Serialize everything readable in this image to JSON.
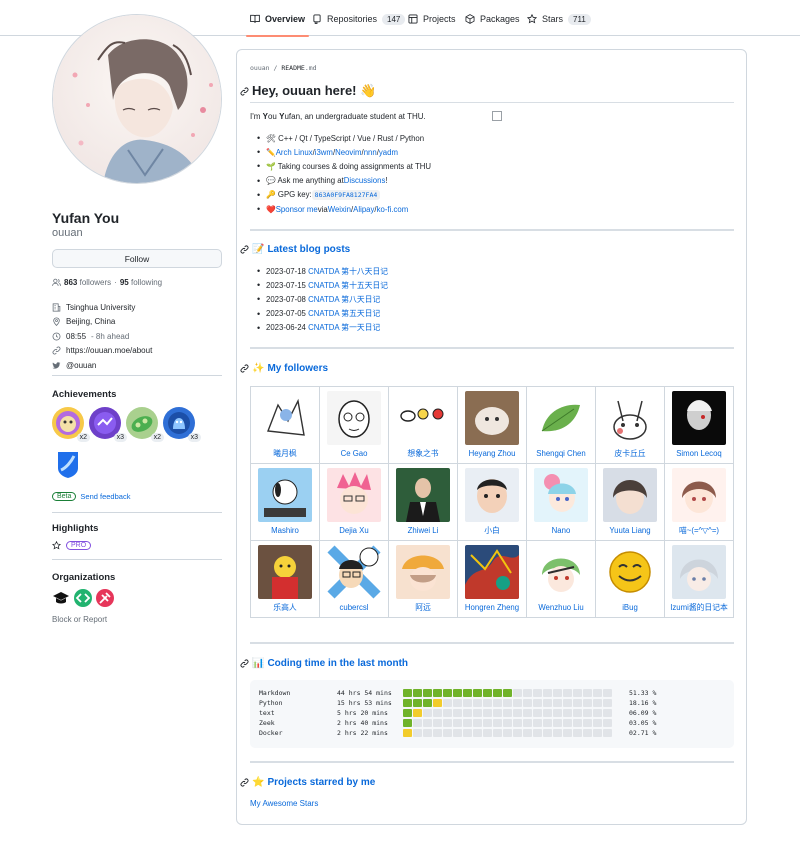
{
  "nav": {
    "tabs": [
      {
        "label": "Overview",
        "count": ""
      },
      {
        "label": "Repositories",
        "count": "147"
      },
      {
        "label": "Projects",
        "count": ""
      },
      {
        "label": "Packages",
        "count": ""
      },
      {
        "label": "Stars",
        "count": "711"
      }
    ]
  },
  "profile": {
    "name": "Yufan You",
    "login": "ouuan",
    "follow_label": "Follow",
    "followers_count": "863",
    "followers_label": "followers",
    "dot": "·",
    "following_count": "95",
    "following_label": "following",
    "org": "Tsinghua University",
    "location": "Beijing, China",
    "time": "08:55",
    "time_note": "- 8h ahead",
    "website": "https://ouuan.moe/about",
    "twitter": "@ouuan"
  },
  "achievements": {
    "title": "Achievements",
    "badges": [
      {
        "icon": "pull-shark-icon",
        "count": "x2",
        "color": "#f7c948"
      },
      {
        "icon": "starstruck-icon",
        "count": "x3",
        "color": "#6e40c9"
      },
      {
        "icon": "pair-extraordinaire-icon",
        "count": "x2",
        "color": "#34a853"
      },
      {
        "icon": "galaxy-brain-icon",
        "count": "x3",
        "color": "#2f6fd6"
      },
      {
        "icon": "yolo-icon",
        "count": "",
        "color": "#1f6feb"
      }
    ],
    "beta": "Beta",
    "feedback": "Send feedback"
  },
  "highlights": {
    "title": "Highlights",
    "pro": "PRO"
  },
  "organizations": {
    "title": "Organizations",
    "block": "Block or Report"
  },
  "readme": {
    "crumb_user": "ouuan",
    "crumb_sep": " / ",
    "crumb_file": "README",
    "crumb_ext": ".md",
    "title": "Hey, ouuan here! 👋",
    "intro_pre": "I'm ",
    "intro_y1": "Y",
    "intro_ou": "ou ",
    "intro_y2": "Y",
    "intro_ufan": "ufan",
    "intro_post": ", an undergraduate student at THU.",
    "bullets": {
      "b1": "🛠 C++ / Qt / TypeScript / Vue / Rust / Python",
      "b2_icon": "✏️ ",
      "b2_arch": "Arch Linux",
      "b2_s1": " / ",
      "b2_i3": "i3wm",
      "b2_s2": " / ",
      "b2_nvim": "Neovim",
      "b2_s3": " / ",
      "b2_nnn": "nnn",
      "b2_s4": " / ",
      "b2_yadm": "yadm",
      "b3": "🌱 Taking courses & doing assignments at THU",
      "b4_pre": "💬 Ask me anything at ",
      "b4_link": "Discussions",
      "b4_post": "!",
      "b5_pre": "🔑 GPG key: ",
      "b5_key": "863A0F9FA8127FA4",
      "b6_icon": "❤️ ",
      "b6_sponsor": "Sponsor me",
      "b6_via": " via ",
      "b6_weixin": "Weixin",
      "b6_s1": " / ",
      "b6_alipay": "Alipay",
      "b6_s2": " / ",
      "b6_kofi": "ko-fi.com"
    },
    "blog_icon": "📝 ",
    "blog_title": "Latest blog posts",
    "posts": [
      {
        "date": "2023-07-18",
        "title": "CNATDA 第十八天日记"
      },
      {
        "date": "2023-07-15",
        "title": "CNATDA 第十五天日记"
      },
      {
        "date": "2023-07-08",
        "title": "CNATDA 第八天日记"
      },
      {
        "date": "2023-07-05",
        "title": "CNATDA 第五天日记"
      },
      {
        "date": "2023-06-24",
        "title": "CNATDA 第一天日记"
      }
    ],
    "followers_icon": "✨ ",
    "followers_title": "My followers",
    "followers": [
      [
        "曦月枫",
        "Ce Gao",
        "想象之书",
        "Heyang Zhou",
        "Shengqi Chen",
        "皮卡丘丘",
        "Simon Lecoq"
      ],
      [
        "Mashiro",
        "Dejia Xu",
        "Zhiwei Li",
        "小白",
        "Nano",
        "Yuuta Liang",
        "喵~(=^▽^=)"
      ],
      [
        "乐高人",
        "cubercsl",
        "阿远",
        "Hongren Zheng",
        "Wenzhuo Liu",
        "iBug",
        "Izumi酱的日记本"
      ]
    ],
    "coding_icon": "📊 ",
    "coding_title": "Coding time in the last month",
    "coding": [
      {
        "lang": "Markdown",
        "time": "44 hrs 54 mins",
        "pct": "51.33 %",
        "green": 11,
        "yellow": 0
      },
      {
        "lang": "Python",
        "time": "15 hrs 53 mins",
        "pct": "18.16 %",
        "green": 3,
        "yellow": 1
      },
      {
        "lang": "text",
        "time": "5 hrs 20 mins",
        "pct": "06.09 %",
        "green": 1,
        "yellow": 1
      },
      {
        "lang": "Zeek",
        "time": "2 hrs 40 mins",
        "pct": "03.05 %",
        "green": 1,
        "yellow": 0
      },
      {
        "lang": "Docker",
        "time": "2 hrs 22 mins",
        "pct": "02.71 %",
        "green": 0,
        "yellow": 1
      }
    ],
    "stars_icon": "⭐ ",
    "stars_title": "Projects starred by me",
    "stars_link": "My Awesome Stars"
  },
  "colors": {
    "accent": "#0969da",
    "tab_underline": "#fd8c73",
    "bar_green": "#70b32a",
    "bar_yellow": "#f2cc2b",
    "bar_empty": "#e1e4e8"
  }
}
